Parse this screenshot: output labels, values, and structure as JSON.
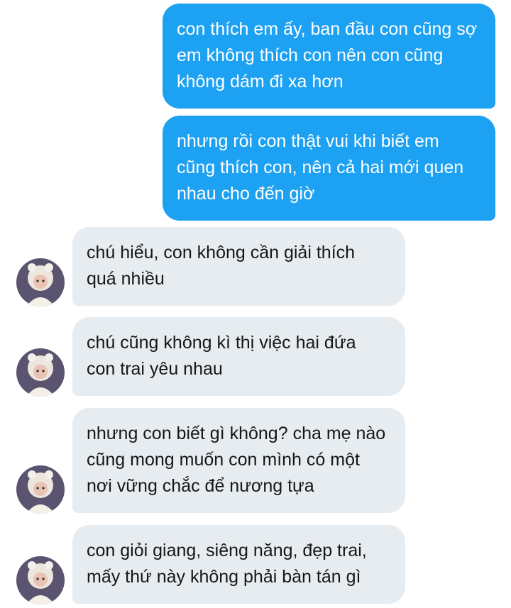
{
  "messages": [
    {
      "direction": "outgoing",
      "text": "con thích em ấy, ban đầu con cũng sợ\nem không thích con nên con cũng\nkhông dám đi xa hơn"
    },
    {
      "direction": "outgoing",
      "text": "nhưng rồi con thật vui khi biết em\ncũng thích con, nên cả hai mới quen\nnhau cho đến giờ"
    },
    {
      "direction": "incoming",
      "avatar": "user-avatar-icon",
      "text": "chú hiểu, con không cần giải thích\nquá nhiều"
    },
    {
      "direction": "incoming",
      "avatar": "user-avatar-icon",
      "text": "chú cũng không kì thị việc hai đứa\ncon trai yêu nhau"
    },
    {
      "direction": "incoming",
      "avatar": "user-avatar-icon",
      "text": "nhưng con biết gì không? cha mẹ nào\ncũng mong muốn con mình có một\nnơi vững chắc để nương tựa"
    },
    {
      "direction": "incoming",
      "avatar": "user-avatar-icon",
      "text": "con giỏi giang, siêng năng, đẹp trai,\nmấy thứ này không phải bàn tán gì"
    }
  ],
  "colors": {
    "outgoing_bubble": "#1da1f2",
    "incoming_bubble": "#e6ecf0",
    "outgoing_text": "#ffffff",
    "incoming_text": "#14171a"
  }
}
